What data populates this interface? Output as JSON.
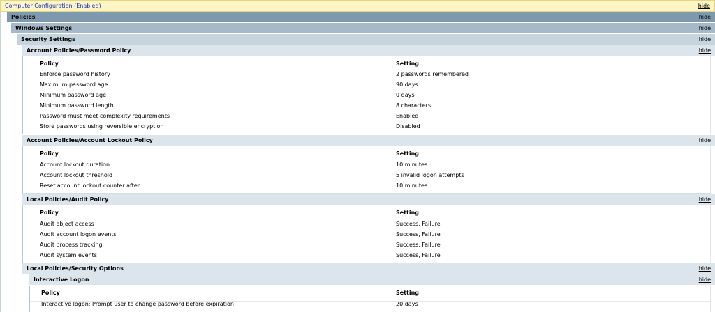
{
  "computer_config": {
    "title": "Computer Configuration (Enabled)",
    "hide_label": "hide"
  },
  "policies": {
    "title": "Policies",
    "hide_label": "hide"
  },
  "windows_settings": {
    "title": "Windows Settings",
    "hide_label": "hide"
  },
  "security_settings": {
    "title": "Security Settings",
    "hide_label": "hide"
  },
  "sections": [
    {
      "title": "Account Policies/Password Policy",
      "hide_label": "hide",
      "col_policy": "Policy",
      "col_setting": "Setting",
      "rows": [
        {
          "policy": "Enforce password history",
          "setting": "2 passwords remembered"
        },
        {
          "policy": "Maximum password age",
          "setting": "90 days"
        },
        {
          "policy": "Minimum password age",
          "setting": "0 days"
        },
        {
          "policy": "Minimum password length",
          "setting": "8 characters"
        },
        {
          "policy": "Password must meet complexity requirements",
          "setting": "Enabled"
        },
        {
          "policy": "Store passwords using reversible encryption",
          "setting": "Disabled"
        }
      ]
    },
    {
      "title": "Account Policies/Account Lockout Policy",
      "hide_label": "hide",
      "col_policy": "Policy",
      "col_setting": "Setting",
      "rows": [
        {
          "policy": "Account lockout duration",
          "setting": "10 minutes"
        },
        {
          "policy": "Account lockout threshold",
          "setting": "5 invalid logon attempts"
        },
        {
          "policy": "Reset account lockout counter after",
          "setting": "10 minutes"
        }
      ]
    },
    {
      "title": "Local Policies/Audit Policy",
      "hide_label": "hide",
      "col_policy": "Policy",
      "col_setting": "Setting",
      "rows": [
        {
          "policy": "Audit object access",
          "setting": "Success, Failure"
        },
        {
          "policy": "Audit account logon events",
          "setting": "Success, Failure"
        },
        {
          "policy": "Audit process tracking",
          "setting": "Success, Failure"
        },
        {
          "policy": "Audit system events",
          "setting": "Success, Failure"
        }
      ]
    },
    {
      "title": "Local Policies/Security Options",
      "hide_label": "hide"
    }
  ],
  "interactive_logon": {
    "title": "Interactive Logon",
    "hide_label": "hide",
    "col_policy": "Policy",
    "col_setting": "Setting",
    "rows": [
      {
        "policy": "Interactive logon: Prompt user to change password before expiration",
        "setting": "20 days"
      }
    ]
  }
}
